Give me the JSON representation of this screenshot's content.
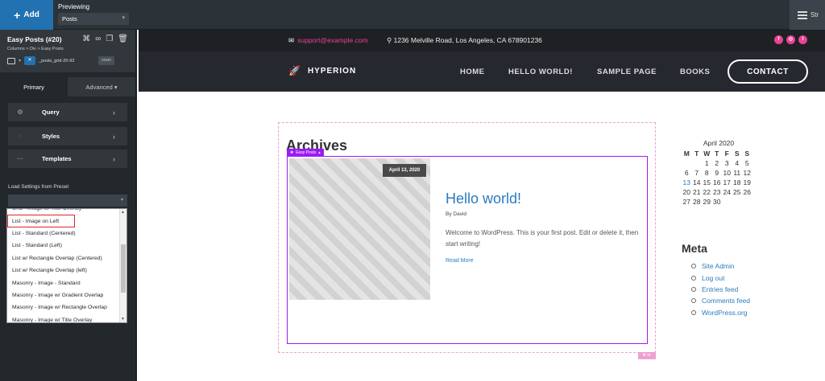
{
  "topbar": {
    "add_label": "Add",
    "previewing_label": "Previewing",
    "previewing_value": "Posts",
    "right_label": "Str"
  },
  "panel": {
    "title": "Easy Posts (#20)",
    "breadcrumb": "Columns > Div > Easy Posts",
    "class_name": "_posts_grid-20-93",
    "state_label": "state",
    "tabs": [
      "Primary",
      "Advanced"
    ],
    "sections": [
      "Query",
      "Styles",
      "Templates"
    ],
    "preset_label": "Load Settings from Preset",
    "preset_options": [
      "Grid - Image w/ Title Overlay",
      "List - Image on Left",
      "List - Standard (Centered)",
      "List - Standard (Left)",
      "List w/ Rectangle Overlap (Centered)",
      "List w/ Rectangle Overlap (left)",
      "Masonry - Image - Standard",
      "Masonry - Image w/ Gradient Overlap",
      "Masonry - Image w/ Rectangle Overlap",
      "Masonry - Image w/ Title Overlay"
    ],
    "highlighted_option": "List - Image on Left"
  },
  "site": {
    "email": "support@example.com",
    "address": "1236 Melville Road, Los Angeles, CA 678901236",
    "logo": "HYPERION",
    "nav": [
      "HOME",
      "HELLO WORLD!",
      "SAMPLE PAGE",
      "BOOKS"
    ],
    "contact": "CONTACT",
    "archives": "Archives",
    "element_badge": "Easy Posts",
    "post": {
      "date": "April 13, 2020",
      "title": "Hello world!",
      "byline": "By David",
      "excerpt": "Welcome to WordPress. This is your first post. Edit or delete it, then start writing!",
      "read_more": "Read More"
    },
    "calendar": {
      "title": "April 2020",
      "headers": [
        "M",
        "T",
        "W",
        "T",
        "F",
        "S",
        "S"
      ],
      "weeks": [
        [
          "",
          "",
          "1",
          "2",
          "3",
          "4",
          "5"
        ],
        [
          "6",
          "7",
          "8",
          "9",
          "10",
          "11",
          "12"
        ],
        [
          "13",
          "14",
          "15",
          "16",
          "17",
          "18",
          "19"
        ],
        [
          "20",
          "21",
          "22",
          "23",
          "24",
          "25",
          "26"
        ],
        [
          "27",
          "28",
          "29",
          "30",
          "",
          "",
          ""
        ]
      ],
      "linked_day": "13"
    },
    "meta_heading": "Meta",
    "meta_links": [
      "Site Admin",
      "Log out",
      "Entries feed",
      "Comments feed",
      "WordPress.org"
    ]
  }
}
